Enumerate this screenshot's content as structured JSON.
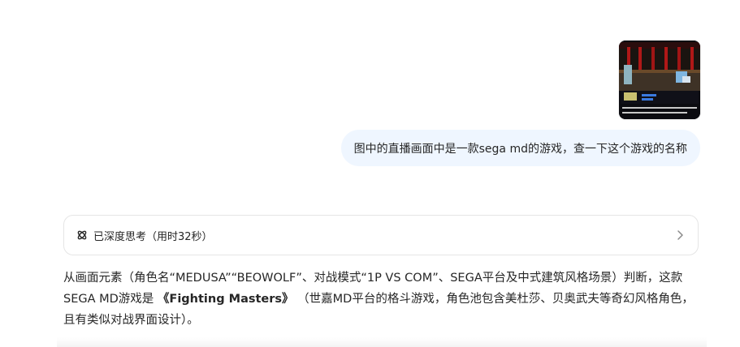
{
  "conversation": {
    "user_image": {
      "icon": "game-screenshot-thumbnail"
    },
    "user_message": "图中的直播画面中是一款sega md的游戏，查一下这个游戏的名称",
    "thinking": {
      "label": "已深度思考（用时32秒）"
    },
    "answer": {
      "part1": "从画面元素（角色名“MEDUSA”“BEOWOLF”、对战模式“1P VS COM”、SEGA平台及中式建筑风格场景）判断，这款SEGA MD游戏是 ",
      "title": "《Fighting Masters》",
      "part2": " （世嘉MD平台的格斗游戏，角色池包含美杜莎、贝奥武夫等奇幻风格角色，且有类似对战界面设计）。"
    }
  },
  "colors": {
    "user_bubble_bg": "#eff6ff",
    "border": "#e5e5e5",
    "text": "#262626"
  }
}
